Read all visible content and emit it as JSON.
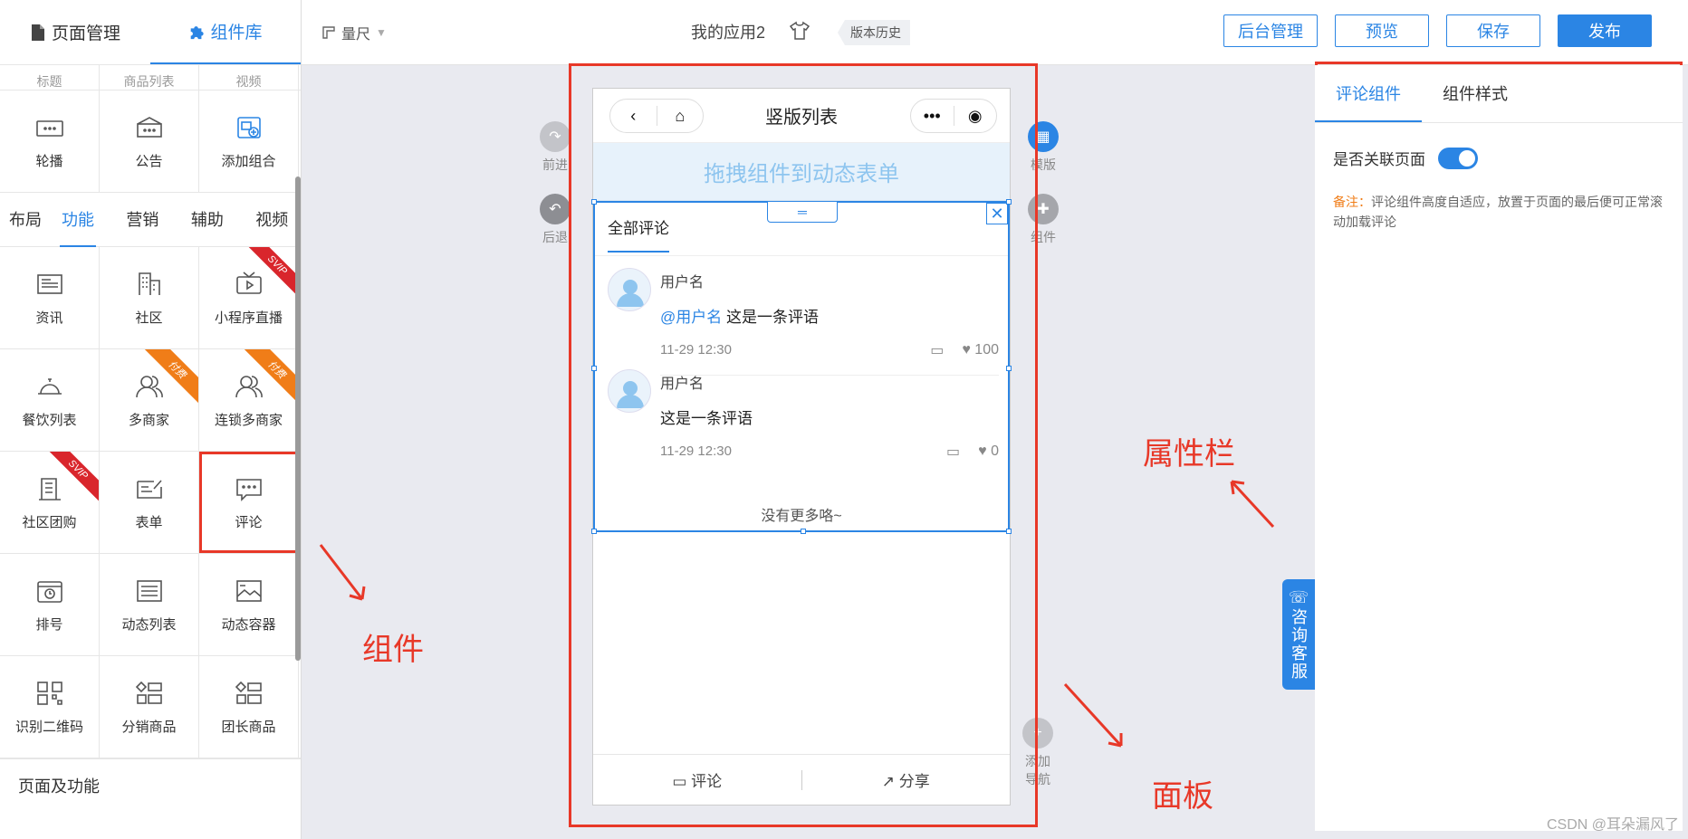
{
  "left_tabs": {
    "page_mgmt": "页面管理",
    "component_lib": "组件库"
  },
  "partial_row": [
    "标题",
    "商品列表",
    "视频"
  ],
  "grid_top": [
    {
      "label": "轮播",
      "icon": "carousel-icon"
    },
    {
      "label": "公告",
      "icon": "notice-icon"
    },
    {
      "label": "添加组合",
      "icon": "add-combo-icon"
    }
  ],
  "category_tabs": [
    "布局",
    "功能",
    "营销",
    "辅助",
    "视频"
  ],
  "grid_func": [
    {
      "label": "资讯",
      "icon": "news-icon"
    },
    {
      "label": "社区",
      "icon": "community-icon"
    },
    {
      "label": "小程序直播",
      "icon": "live-icon",
      "badge": "SVIP"
    },
    {
      "label": "餐饮列表",
      "icon": "dining-icon"
    },
    {
      "label": "多商家",
      "icon": "merchants-icon",
      "badge": "付费"
    },
    {
      "label": "连锁多商家",
      "icon": "chain-merchants-icon",
      "badge": "付费"
    },
    {
      "label": "社区团购",
      "icon": "group-buy-icon",
      "badge": "SVIP"
    },
    {
      "label": "表单",
      "icon": "form-icon"
    },
    {
      "label": "评论",
      "icon": "comment-icon"
    },
    {
      "label": "排号",
      "icon": "queue-icon"
    },
    {
      "label": "动态列表",
      "icon": "dynamic-list-icon"
    },
    {
      "label": "动态容器",
      "icon": "dynamic-container-icon"
    },
    {
      "label": "识别二维码",
      "icon": "qrcode-icon"
    },
    {
      "label": "分销商品",
      "icon": "distribution-icon"
    },
    {
      "label": "团长商品",
      "icon": "leader-goods-icon"
    }
  ],
  "section_title": "页面及功能",
  "topbar": {
    "ruler": "量尺",
    "app_name": "我的应用2",
    "history": "版本历史",
    "btn_backend": "后台管理",
    "btn_preview": "预览",
    "btn_save": "保存",
    "btn_publish": "发布"
  },
  "side_tools": {
    "forward": "前进",
    "back": "后退",
    "template": "模版",
    "component": "组件",
    "add_nav_1": "添加",
    "add_nav_2": "导航"
  },
  "phone": {
    "title": "竖版列表",
    "drop_hint": "拖拽组件到动态表单",
    "comment_tab": "全部评论",
    "comments": [
      {
        "user": "用户名",
        "mention": "@用户名",
        "text": "这是一条评语",
        "time": "11-29 12:30",
        "likes": "100"
      },
      {
        "user": "用户名",
        "mention": "",
        "text": "这是一条评语",
        "time": "11-29 12:30",
        "likes": "0"
      }
    ],
    "no_more": "没有更多咯~",
    "foot_comment": "评论",
    "foot_share": "分享"
  },
  "annotations": {
    "component": "组件",
    "panel": "面板",
    "property": "属性栏"
  },
  "right": {
    "tab_comment": "评论组件",
    "tab_style": "组件样式",
    "link_page_label": "是否关联页面",
    "link_page_on": true,
    "note_label": "备注：",
    "note_text": "评论组件高度自适应，放置于页面的最后便可正常滚动加载评论"
  },
  "consult": "咨询客服",
  "watermark": "CSDN @耳朵漏风了",
  "colors": {
    "accent": "#2b85e4",
    "annotation_red": "#e83828",
    "svip": "#d9262c",
    "paid": "#f07d18"
  }
}
